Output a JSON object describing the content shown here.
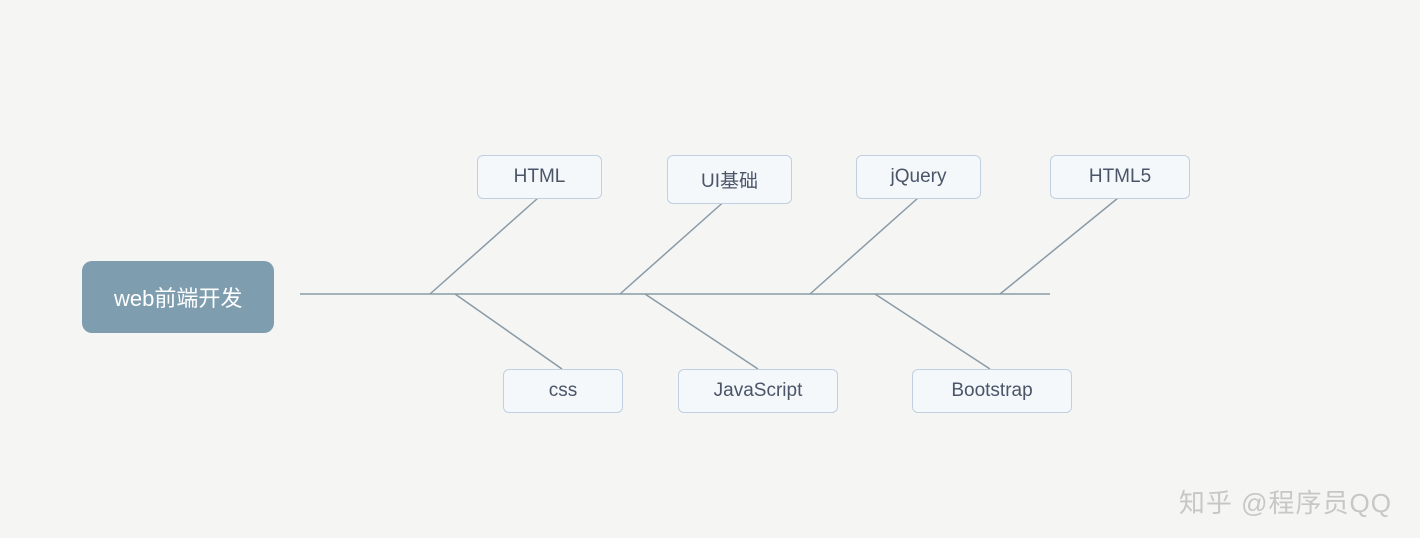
{
  "diagram": {
    "root": "web前端开发",
    "branches": {
      "top": [
        "HTML",
        "UI基础",
        "jQuery",
        "HTML5"
      ],
      "bottom": [
        "css",
        "JavaScript",
        "Bootstrap"
      ]
    }
  },
  "watermark": "知乎 @程序员QQ",
  "colors": {
    "root_bg": "#7e9eaf",
    "node_bg": "#f5f8fb",
    "node_border": "#c0d0e0",
    "line": "#8a9ba8"
  }
}
